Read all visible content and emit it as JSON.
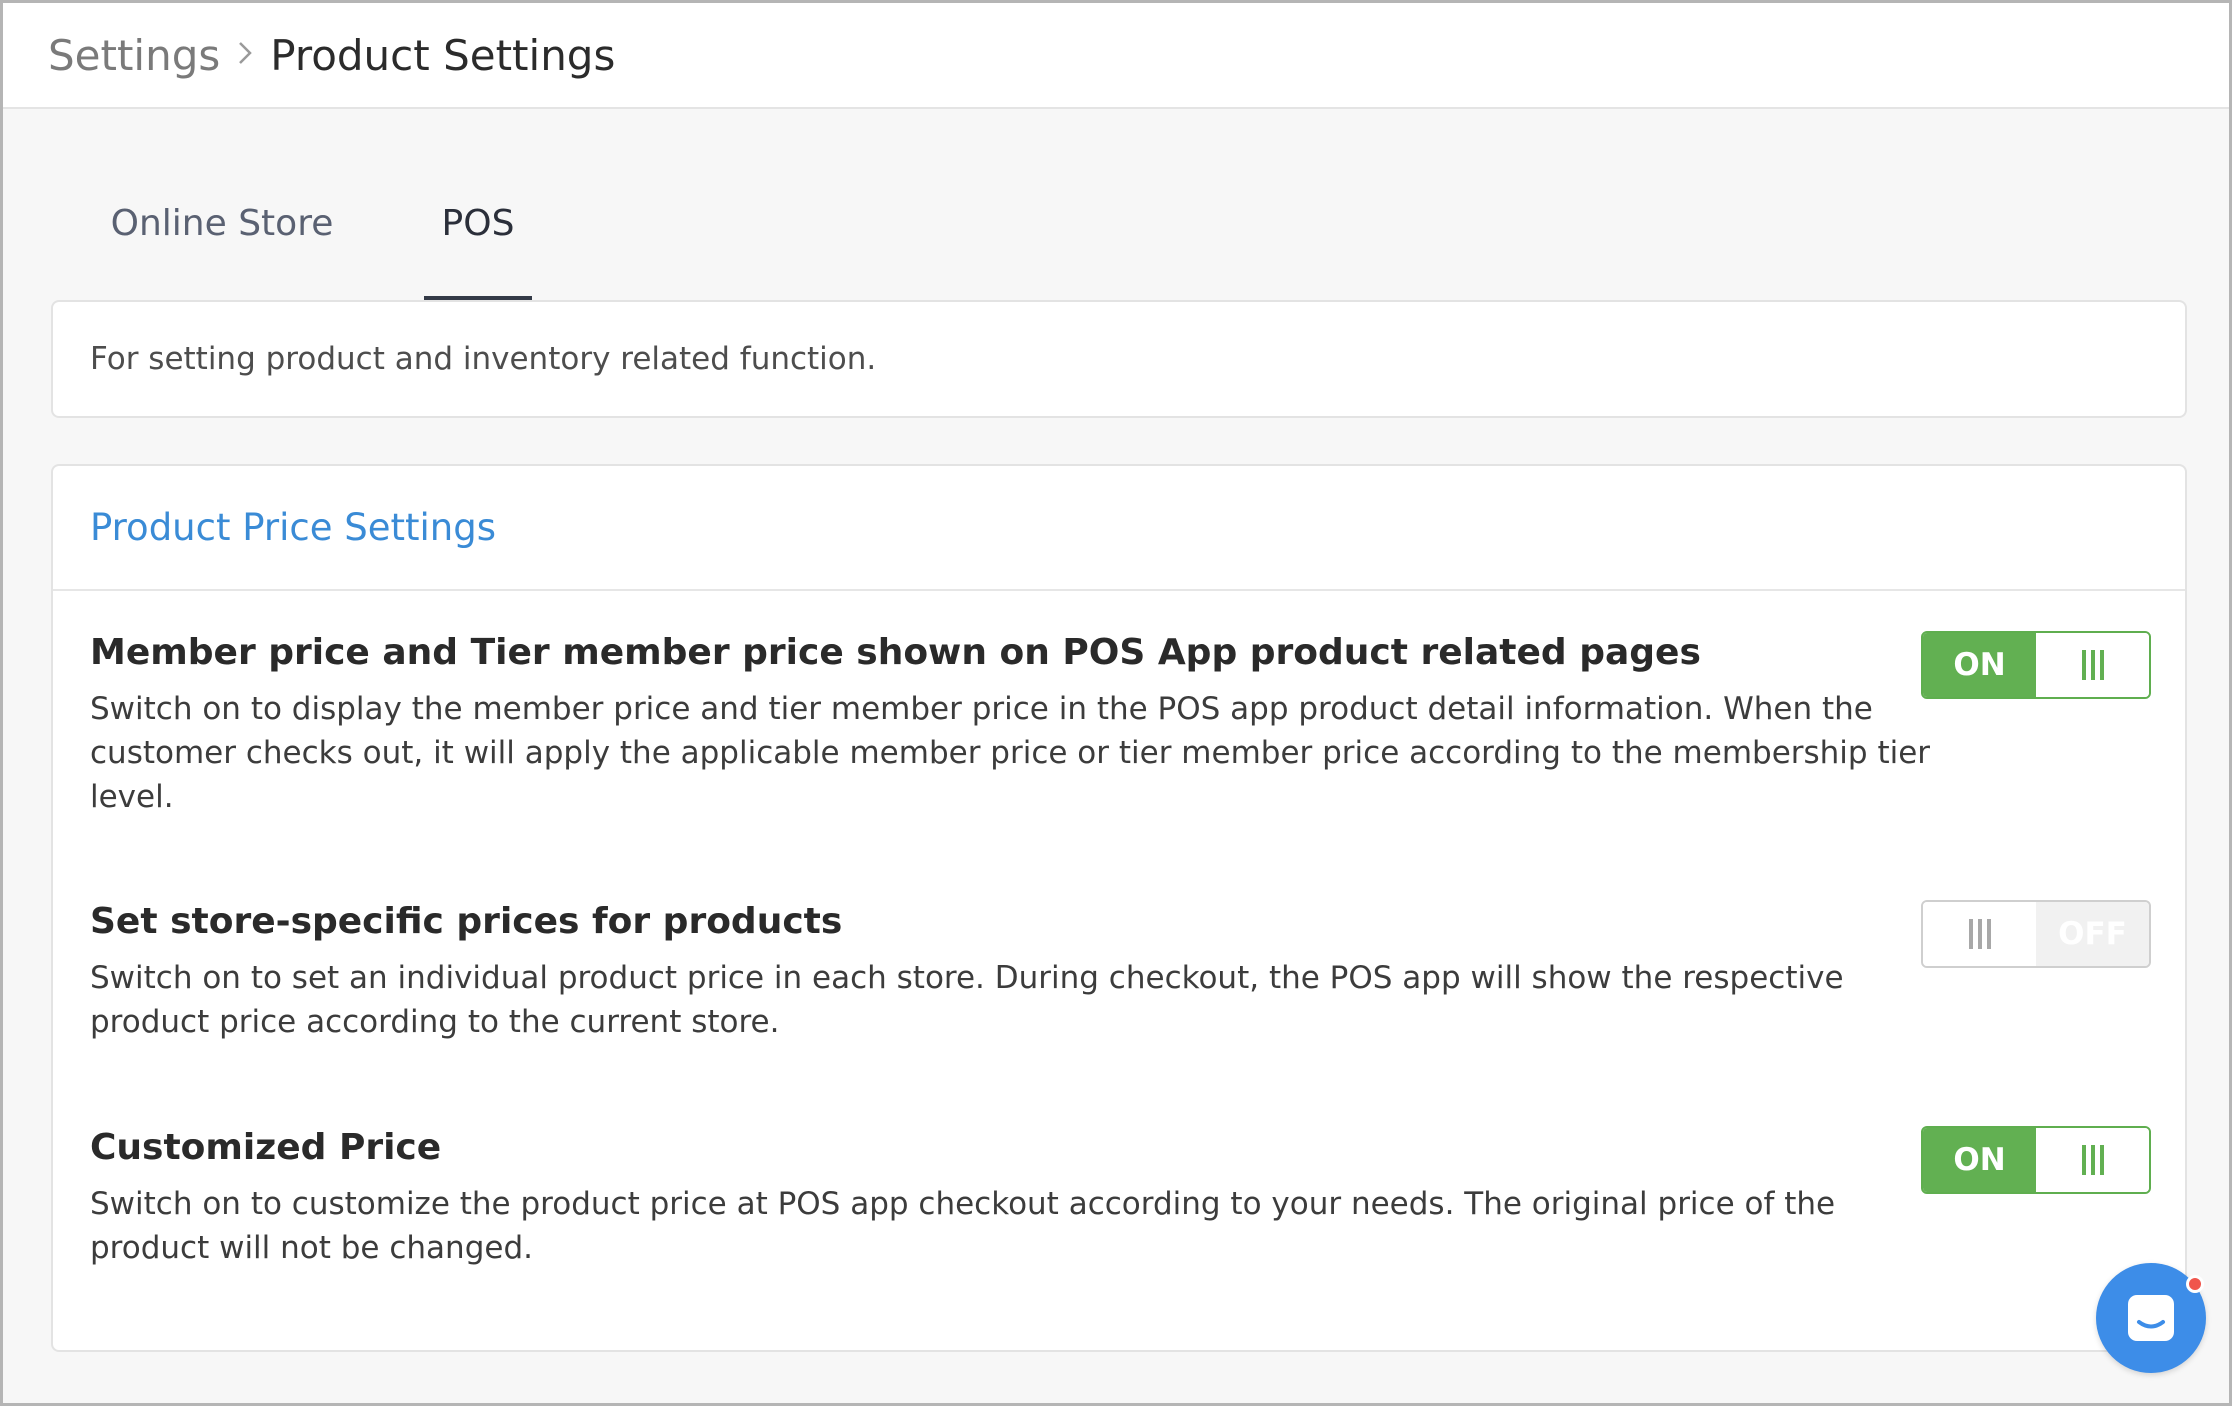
{
  "breadcrumb": {
    "root": "Settings",
    "separator": ">",
    "current": "Product Settings"
  },
  "tabs": [
    {
      "label": "Online Store",
      "active": false
    },
    {
      "label": "POS",
      "active": true
    }
  ],
  "description": "For setting product and inventory related function.",
  "section": {
    "title": "Product Price Settings",
    "settings": [
      {
        "title": "Member price and Tier member price shown on POS App product related pages",
        "description": "Switch on to display the member price and tier member price in the POS app product detail information. When the customer checks out, it will apply the applicable member price or tier member price according to the membership tier level.",
        "toggle": {
          "state": "on",
          "label": "ON"
        }
      },
      {
        "title": "Set store-specific prices for products",
        "description": "Switch on to set an individual product price in each store. During checkout, the POS app will show the respective product price according to the current store.",
        "toggle": {
          "state": "off",
          "label": "OFF"
        }
      },
      {
        "title": "Customized Price",
        "description": "Switch on to customize the product price at POS app checkout according to your needs. The original price of the product will not be changed.",
        "toggle": {
          "state": "on",
          "label": "ON"
        }
      }
    ]
  },
  "colors": {
    "accent_link": "#3a8bd6",
    "toggle_on": "#62b052",
    "chat_button": "#3d8de8",
    "notification_dot": "#f0554c"
  },
  "icons": {
    "breadcrumb_separator": "chevron-right-icon",
    "toggle_knob": "grip-lines-icon",
    "chat": "chat-bubble-icon"
  }
}
